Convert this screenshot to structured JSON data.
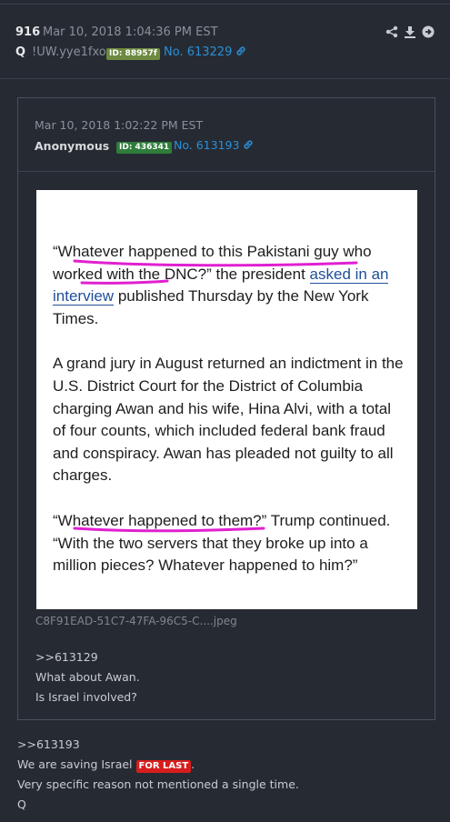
{
  "post": {
    "number": "916",
    "date": "Mar 10, 2018 1:04:36 PM EST",
    "author": "Q",
    "tripcode": "!UW.yye1fxo",
    "id_badge": "ID: 88957f",
    "post_no": "No. 613229",
    "body": {
      "reply_ref": ">>613193",
      "line1_prefix": "We are saving Israel",
      "tag": "FOR LAST",
      "line1_suffix": ".",
      "line2": "Very specific reason not mentioned a single time.",
      "signature": "Q"
    }
  },
  "quoted": {
    "date": "Mar 10, 2018 1:02:22 PM EST",
    "author": "Anonymous",
    "id_badge": "ID: 436341",
    "post_no": "No. 613193",
    "filename": "C8F91EAD-51C7-47FA-96C5-C....jpeg",
    "image_text": {
      "p1_a": "“Whatever happened to this Pakistani guy who worked with the DNC?” the president ",
      "p1_link": "asked in an interview",
      "p1_b": " published Thursday by the New York Times.",
      "p2": "A grand jury in August returned an indictment in the U.S. District Court for the District of Columbia charging Awan and his wife, Hina Alvi, with a total of four counts, which included federal bank fraud and conspiracy. Awan has pleaded not guilty to all charges.",
      "p3": "“Whatever happened to them?” Trump continued. “With the two servers that they broke up into a million pieces? Whatever happened to him?”"
    },
    "body": {
      "reply_ref": ">>613129",
      "line1": "What about Awan.",
      "line2": "Is Israel involved?"
    }
  },
  "colors": {
    "background": "#262b33",
    "link": "#2a8fd8",
    "q_badge": "#6d8a3f",
    "anon_badge": "#2e7d3a",
    "tag_red": "#d61d1d",
    "highlight": "#e020d0"
  },
  "icons": [
    "share-icon",
    "download-icon",
    "arrow-circle-icon",
    "link-icon"
  ]
}
